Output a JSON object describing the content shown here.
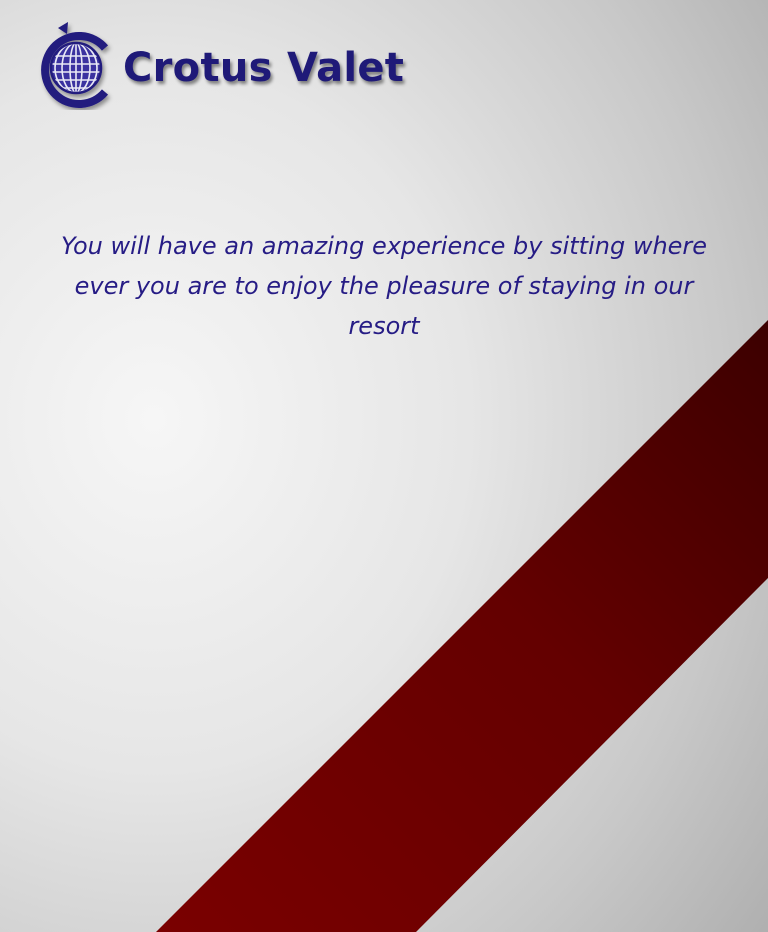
{
  "brand": {
    "name": "Crotus Valet",
    "logo_icon": "globe-c-icon",
    "color": "#1f1a78"
  },
  "content": {
    "tagline": "You will have an amazing experience by sitting where ever you are to enjoy the pleasure of staying in our resort"
  },
  "theme": {
    "background": "#e8e8e8",
    "ribbon_color": "#6e0000",
    "text_color": "#261c85"
  }
}
